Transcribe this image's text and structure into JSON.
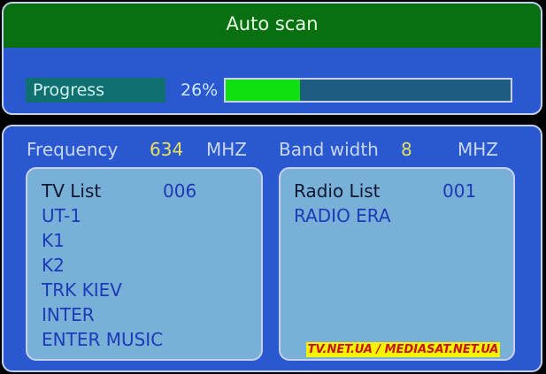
{
  "header": {
    "title": "Auto scan"
  },
  "progress": {
    "label": "Progress",
    "percent_text": "26%",
    "fraction": 0.26
  },
  "frequency": {
    "label": "Frequency",
    "value": "634",
    "unit": "MHZ"
  },
  "bandwidth": {
    "label": "Band width",
    "value": "8",
    "unit": "MHZ"
  },
  "tv_list": {
    "label": "TV List",
    "count": "006",
    "items": [
      "UT-1",
      "K1",
      "K2",
      "TRK KIEV",
      "INTER",
      "ENTER MUSIC"
    ]
  },
  "radio_list": {
    "label": "Radio List",
    "count": "001",
    "items": [
      "RADIO ERA"
    ]
  },
  "watermark": "TV.NET.UA / MEDIASAT.NET.UA",
  "colors": {
    "accent_green": "#087010",
    "panel_blue": "#2a58d0",
    "progress_fill": "#10e010",
    "list_bg": "#78b0d8"
  }
}
